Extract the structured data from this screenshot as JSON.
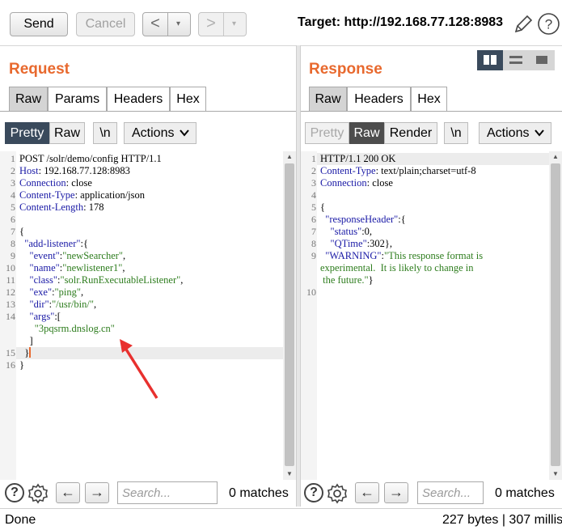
{
  "toolbar": {
    "send": "Send",
    "cancel": "Cancel",
    "back_arrow": "<",
    "forward_arrow": ">",
    "dropdown": "▾",
    "target_label": "Target: http://192.168.77.128:8983",
    "edit_icon": "pencil-icon",
    "help_icon": "help-icon"
  },
  "request": {
    "title": "Request",
    "tabs": [
      "Raw",
      "Params",
      "Headers",
      "Hex"
    ],
    "active_tab": "Raw",
    "view_modes": [
      "Pretty",
      "Raw",
      "\\n"
    ],
    "actions": "Actions",
    "line_numbers": [
      "1",
      "2",
      "3",
      "4",
      "5",
      "6",
      "7",
      "8",
      "9",
      "10",
      "11",
      "12",
      "13",
      "14",
      "",
      "",
      "15",
      "16"
    ],
    "search_placeholder": "Search...",
    "matches": "0 matches"
  },
  "response": {
    "title": "Response",
    "tabs": [
      "Raw",
      "Headers",
      "Hex"
    ],
    "active_tab": "Raw",
    "view_modes": [
      "Pretty",
      "Raw",
      "Render",
      "\\n"
    ],
    "actions": "Actions",
    "search_placeholder": "Search...",
    "matches": "0 matches"
  },
  "status": {
    "left": "Done",
    "right": "227 bytes | 307 millis"
  },
  "colors": {
    "accent": "#e8692e",
    "active_mode": "#3a4a5c",
    "key": "#1a1aa6",
    "string": "#2e7d1e",
    "annotation_arrow": "#e8302e"
  }
}
